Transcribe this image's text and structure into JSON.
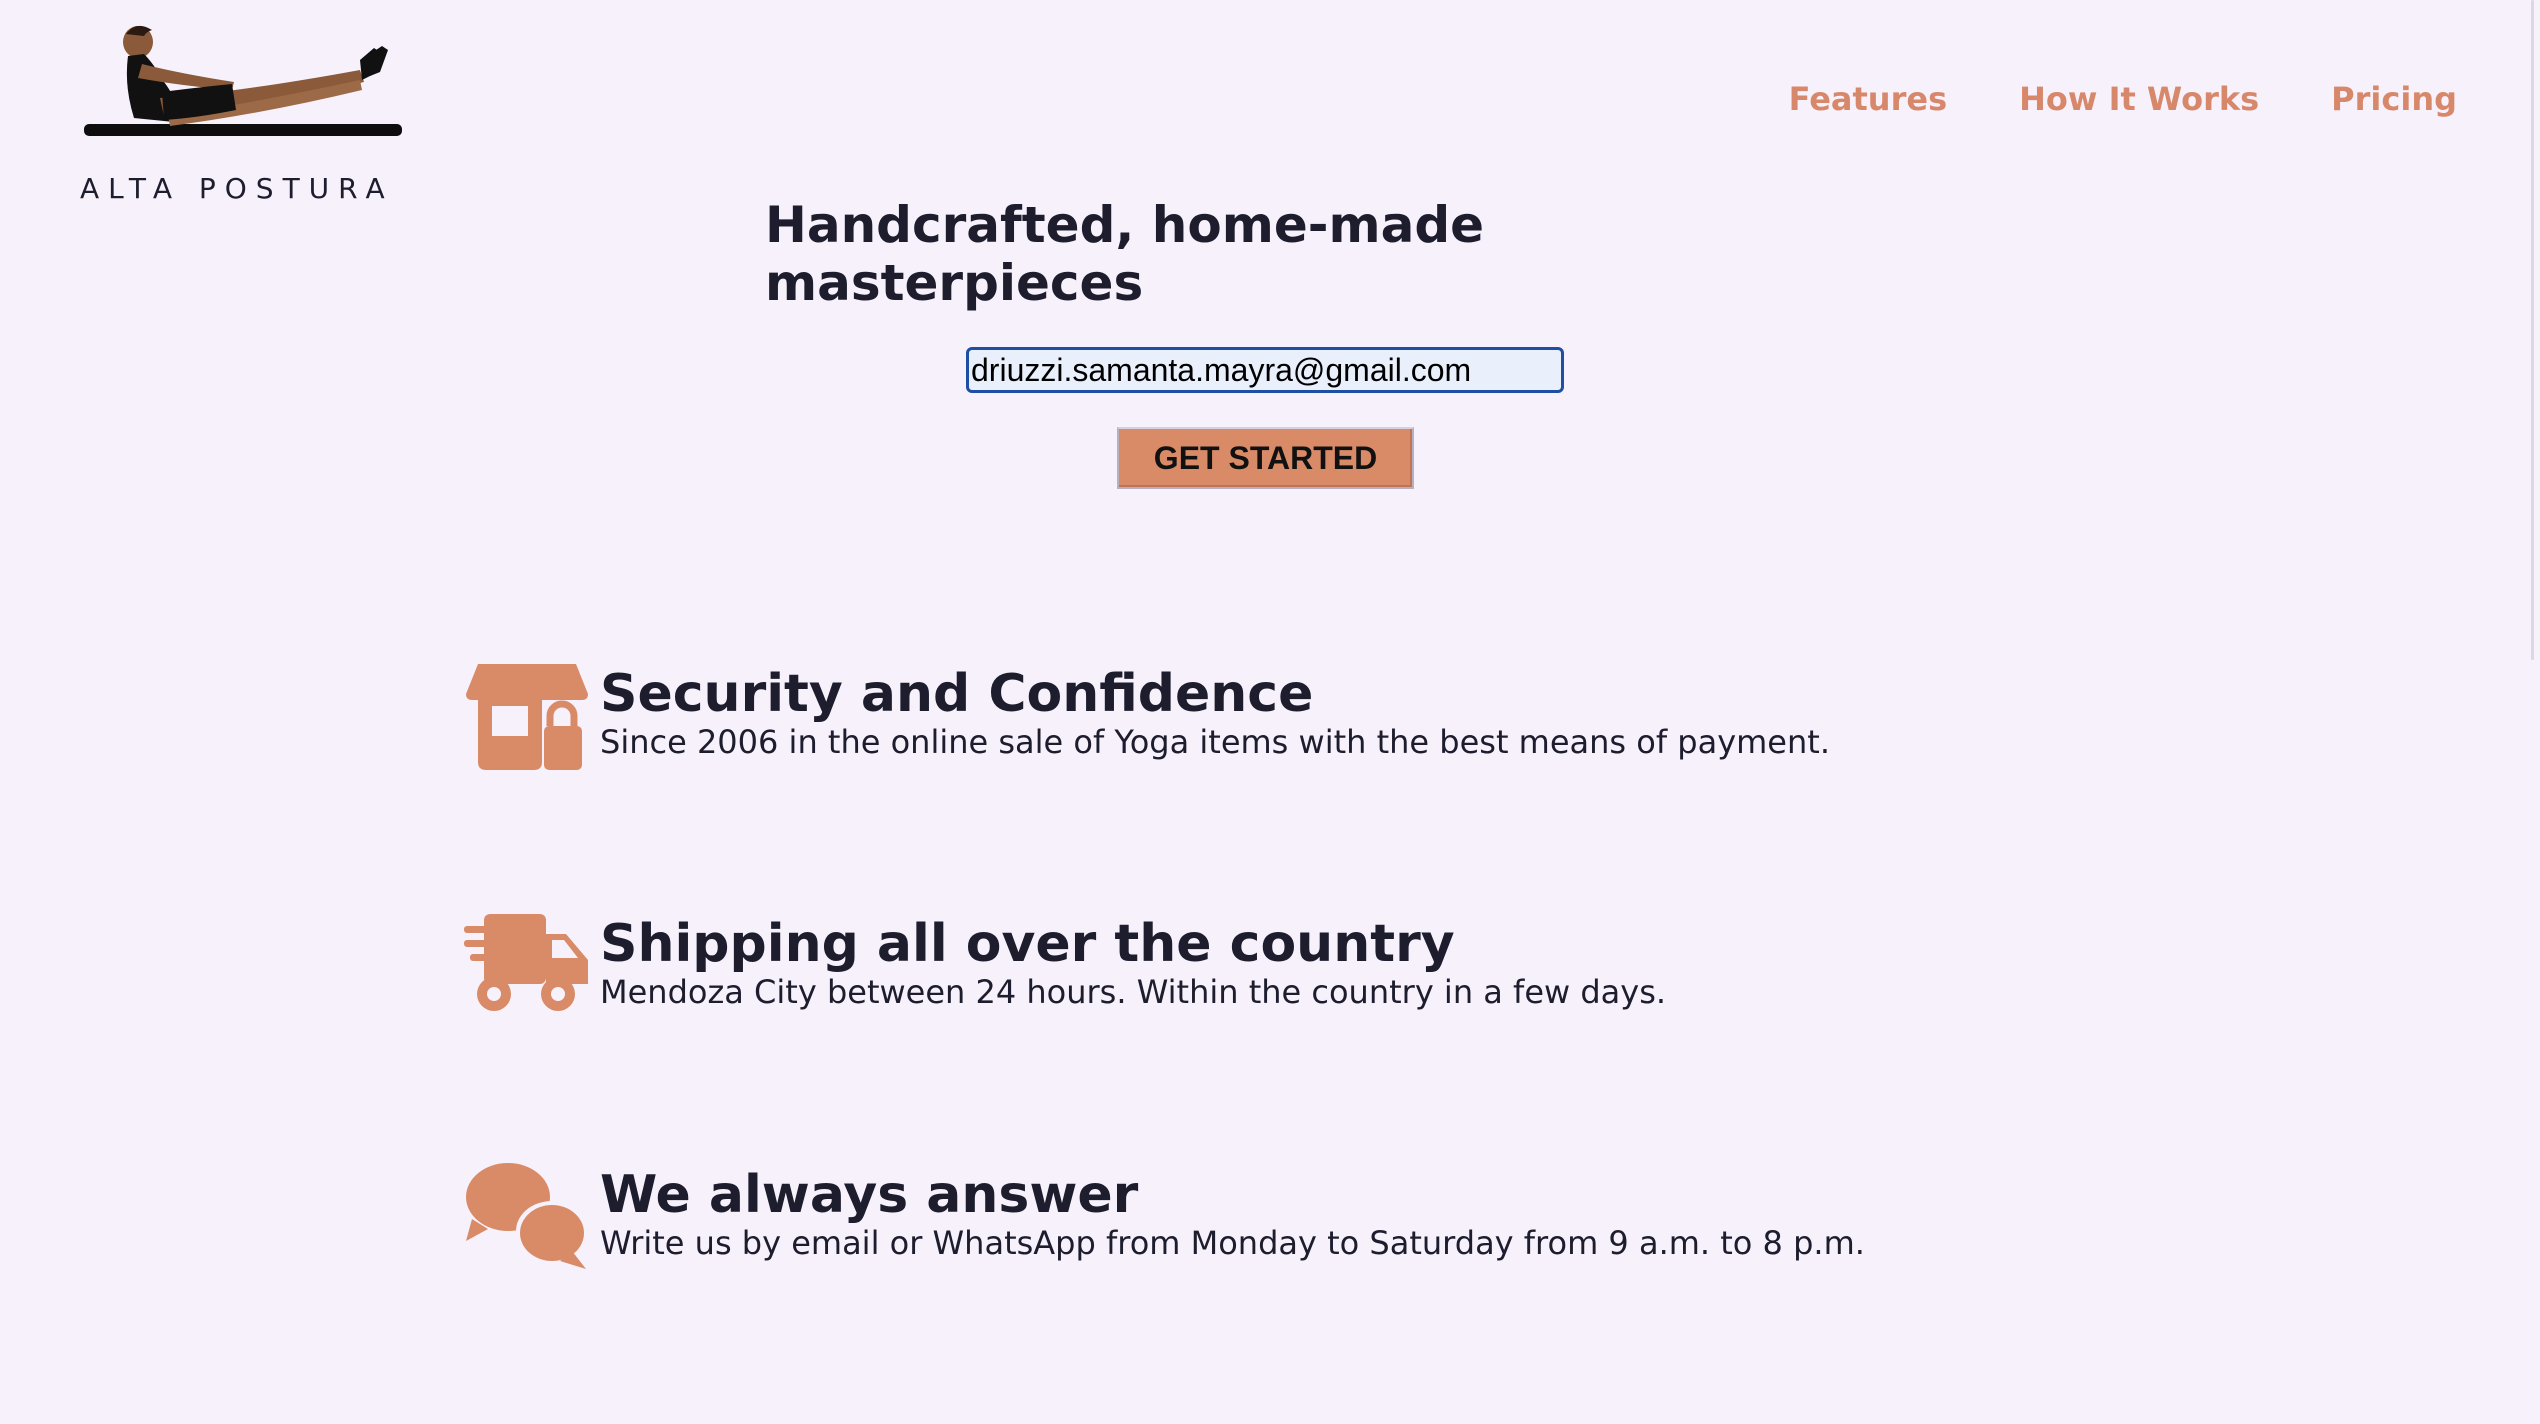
{
  "brand": {
    "name": "ALTA POSTURA",
    "logo_icon": "yoga-pose-logo-icon",
    "accent_color": "#d8886a"
  },
  "nav": {
    "items": [
      {
        "label": "Features"
      },
      {
        "label": "How It Works"
      },
      {
        "label": "Pricing"
      }
    ]
  },
  "hero": {
    "title": "Handcrafted, home-made masterpieces",
    "email_value": "driuzzi.samanta.mayra@gmail.com",
    "cta_label": "GET STARTED"
  },
  "features": [
    {
      "icon": "shop-lock-icon",
      "title": "Security and Confidence",
      "description": "Since 2006 in the online sale of Yoga items with the best means of payment."
    },
    {
      "icon": "fast-truck-icon",
      "title": "Shipping all over the country",
      "description": "Mendoza City between 24 hours. Within the country in a few days."
    },
    {
      "icon": "chat-bubbles-icon",
      "title": "We always answer",
      "description": "Write us by email or WhatsApp from Monday to Saturday from 9 a.m. to 8 p.m."
    }
  ]
}
